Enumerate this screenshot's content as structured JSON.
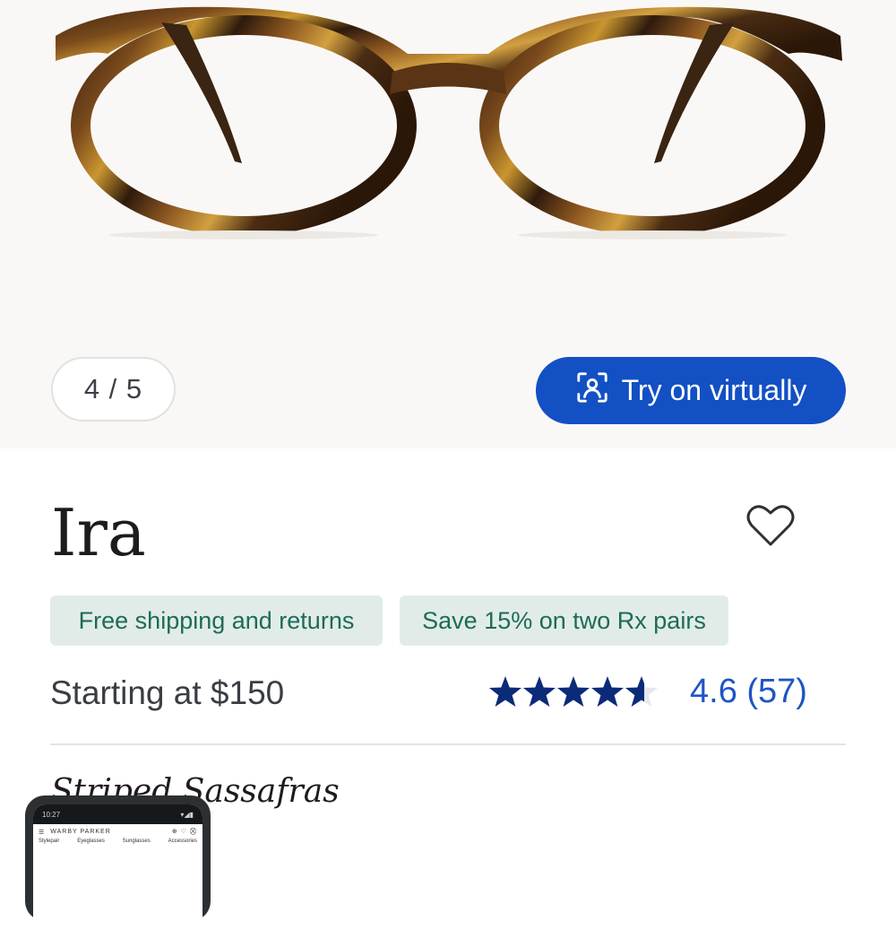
{
  "gallery": {
    "counter": "4 / 5",
    "try_on_label": "Try on virtually",
    "try_on_color": "#1350c4"
  },
  "product": {
    "name": "Ira",
    "badges": [
      "Free shipping and returns",
      "Save 15% on two Rx pairs"
    ],
    "price": "Starting at $150",
    "rating_value": 4.6,
    "rating_text": "4.6 (57)",
    "color_name": "Striped Sassafras"
  },
  "phone_preview": {
    "time": "10:27",
    "brand": "WARBY PARKER",
    "categories": [
      "Stylepair",
      "Eyeglasses",
      "Sunglasses",
      "Accessories"
    ]
  },
  "icons": [
    "scan-face-icon",
    "heart-icon",
    "star-icon",
    "menu-icon",
    "cart-icon"
  ]
}
